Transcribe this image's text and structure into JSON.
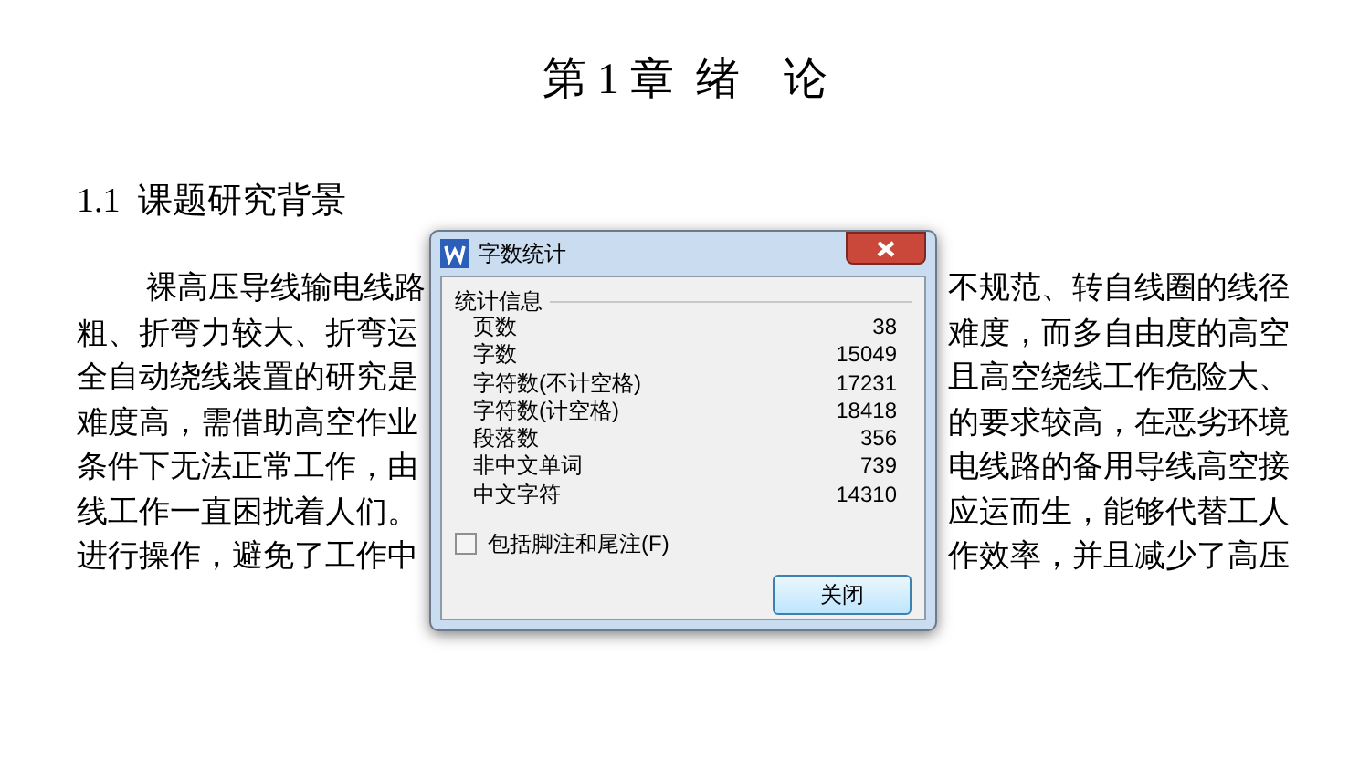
{
  "document": {
    "chapter_title": "第 1 章  绪    论",
    "section_heading": "1.1  课题研究背景",
    "lines": [
      {
        "left": "裸高压导线输电线路",
        "right": "不规范、转自线圈的线径",
        "indent": true
      },
      {
        "left": "粗、折弯力较大、折弯运",
        "right": "难度，而多自由度的高空",
        "indent": false
      },
      {
        "left": "全自动绕线装置的研究是",
        "right": "且高空绕线工作危险大、",
        "indent": false
      },
      {
        "left": "难度高，需借助高空作业",
        "right": "的要求较高，在恶劣环境",
        "indent": false
      },
      {
        "left": "条件下无法正常工作，由",
        "right": "电线路的备用导线高空接",
        "indent": false
      },
      {
        "left": "线工作一直困扰着人们。",
        "right": "应运而生，能够代替工人",
        "indent": false
      },
      {
        "left": "进行操作，避免了工作中",
        "right": "作效率，并且减少了高压",
        "indent": false
      }
    ]
  },
  "dialog": {
    "title": "字数统计",
    "group_label": "统计信息",
    "stats": [
      {
        "label": "页数",
        "value": "38"
      },
      {
        "label": "字数",
        "value": "15049"
      },
      {
        "label": "字符数(不计空格)",
        "value": "17231"
      },
      {
        "label": "字符数(计空格)",
        "value": "18418"
      },
      {
        "label": "段落数",
        "value": "356"
      },
      {
        "label": "非中文单词",
        "value": "739"
      },
      {
        "label": "中文字符",
        "value": "14310"
      }
    ],
    "include_footnotes": {
      "label": "包括脚注和尾注(F)",
      "checked": false
    },
    "close_button": "关闭"
  }
}
